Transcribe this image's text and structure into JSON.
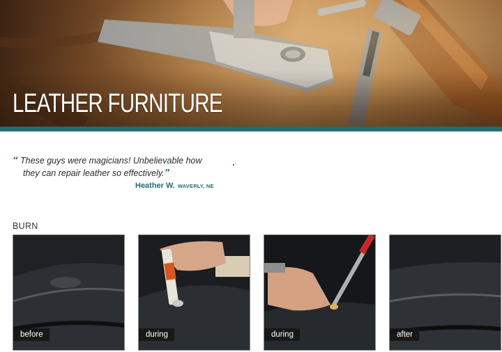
{
  "hero": {
    "title": "LEATHER FURNITURE"
  },
  "testimonial": {
    "open_quote": "“",
    "line1": "These guys were magicians! Unbelievable how",
    "line2": "they can repair leather so effectively.",
    "close_quote": "”",
    "author": "Heather W.",
    "location": "WAVERLY, NE"
  },
  "section": {
    "label": "BURN"
  },
  "photos": [
    {
      "caption": "before"
    },
    {
      "caption": "during"
    },
    {
      "caption": "during"
    },
    {
      "caption": "after"
    }
  ],
  "colors": {
    "accent": "#1f6e73",
    "text": "#2a2a2a",
    "caption_bg": "#141414"
  }
}
